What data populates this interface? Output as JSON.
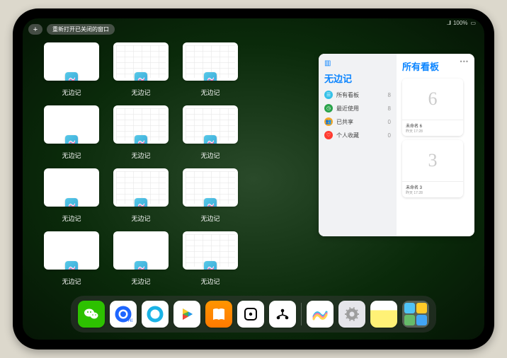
{
  "status": {
    "carrier": "...ll",
    "wifi": "WiFi",
    "battery": "100%"
  },
  "top": {
    "plus": "+",
    "reopen": "重新打开已关闭的窗口"
  },
  "app_label": "无边记",
  "thumb_types": [
    "plain",
    "grid",
    "grid",
    "",
    "plain",
    "grid",
    "grid",
    "",
    "plain",
    "grid",
    "grid",
    "",
    "plain",
    "plain",
    "grid",
    ""
  ],
  "panel": {
    "title": "无边记",
    "items": [
      {
        "label": "所有看板",
        "count": "8",
        "color": "#34c1e8",
        "glyph": "☰"
      },
      {
        "label": "最近使用",
        "count": "8",
        "color": "#2aa34a",
        "glyph": "◷"
      },
      {
        "label": "已共享",
        "count": "0",
        "color": "#f5a623",
        "glyph": "👥"
      },
      {
        "label": "个人收藏",
        "count": "0",
        "color": "#ff3b30",
        "glyph": "♡"
      }
    ],
    "right_title": "所有看板",
    "boards": [
      {
        "glyph": "6",
        "name": "未命名 6",
        "time": "昨天 17:28"
      },
      {
        "glyph": "3",
        "name": "未命名 3",
        "time": "昨天 17:28"
      }
    ]
  },
  "dock": [
    {
      "name": "wechat",
      "bg": "#2dc100",
      "svg": "wechat"
    },
    {
      "name": "qqbrowser",
      "bg": "#ffffff",
      "svg": "ring-blue"
    },
    {
      "name": "quark",
      "bg": "#ffffff",
      "svg": "ring-teal"
    },
    {
      "name": "play",
      "bg": "#ffffff",
      "svg": "play"
    },
    {
      "name": "books",
      "bg": "linear-gradient(#ff9500,#ff7a00)",
      "svg": "book"
    },
    {
      "name": "dice",
      "bg": "#ffffff",
      "svg": "dice"
    },
    {
      "name": "mind",
      "bg": "#ffffff",
      "svg": "mind"
    }
  ],
  "dock_suggested": [
    {
      "name": "freeform",
      "bg": "#ffffff",
      "svg": "freeform"
    },
    {
      "name": "settings",
      "bg": "#e5e5ea",
      "svg": "gear"
    },
    {
      "name": "notes",
      "bg": "linear-gradient(#fff 35%, #fff176 35%)",
      "svg": ""
    }
  ],
  "dock_library_colors": [
    "#4fc3f7",
    "#ffca28",
    "#66bb6a",
    "#42a5f5"
  ]
}
